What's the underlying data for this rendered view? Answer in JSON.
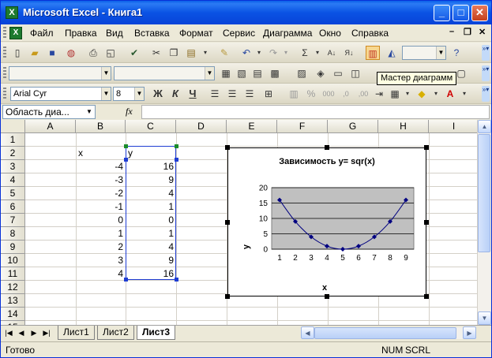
{
  "window": {
    "title": "Microsoft Excel - Книга1",
    "app_icon": "X",
    "minimize_icon": "_",
    "maximize_icon": "□",
    "close_icon": "✕"
  },
  "menu": {
    "items": [
      "Файл",
      "Правка",
      "Вид",
      "Вставка",
      "Формат",
      "Сервис",
      "Диаграмма",
      "Окно",
      "Справка"
    ],
    "doc_minimize": "–",
    "doc_restore": "❐",
    "doc_close": "✕"
  },
  "toolbar_format": {
    "font": "Arial Cyr",
    "size": "8",
    "bold": "Ж",
    "italic": "К",
    "underline": "Ч"
  },
  "tooltip": "Мастер диаграмм",
  "formula_bar": {
    "name_box": "Область диа...",
    "fx": "fx",
    "value": ""
  },
  "sheet": {
    "columns": [
      "A",
      "B",
      "C",
      "D",
      "E",
      "F",
      "G",
      "H",
      "I"
    ],
    "rows": [
      "1",
      "2",
      "3",
      "4",
      "5",
      "6",
      "7",
      "8",
      "9",
      "10",
      "11",
      "12",
      "13",
      "14",
      "15"
    ],
    "header_x": "x",
    "header_y": "y",
    "x_values": [
      "-4",
      "-3",
      "-2",
      "-1",
      "0",
      "1",
      "2",
      "3",
      "4"
    ],
    "y_values": [
      "16",
      "9",
      "4",
      "1",
      "0",
      "1",
      "4",
      "9",
      "16"
    ]
  },
  "chart_data": {
    "type": "line",
    "title": "Зависимость y= sqr(x)",
    "xlabel": "x",
    "ylabel": "y",
    "categories": [
      "1",
      "2",
      "3",
      "4",
      "5",
      "6",
      "7",
      "8",
      "9"
    ],
    "series": [
      {
        "values": [
          16,
          9,
          4,
          1,
          0,
          1,
          4,
          9,
          16
        ]
      }
    ],
    "ylim": [
      0,
      20
    ],
    "yticks": [
      "0",
      "5",
      "10",
      "15",
      "20"
    ],
    "grid": true,
    "legend": "none",
    "plot_bg_color": "#c0c0c0",
    "line_color": "#000080"
  },
  "tabs": {
    "sheets": [
      "Лист1",
      "Лист2",
      "Лист3"
    ],
    "active": "Лист3"
  },
  "status": {
    "ready": "Готово",
    "num": "NUM",
    "scrl": "SCRL"
  }
}
